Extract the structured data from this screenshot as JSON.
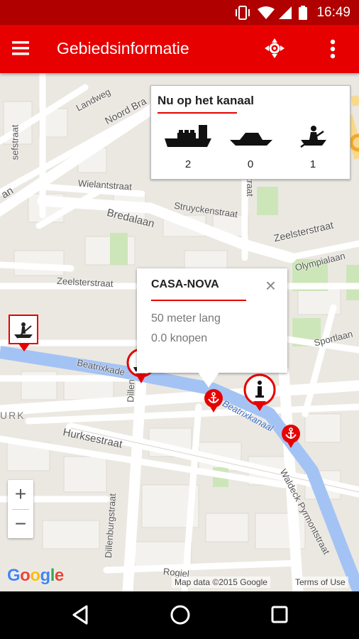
{
  "status_bar": {
    "time": "16:49"
  },
  "app_bar": {
    "title": "Gebiedsinformatie"
  },
  "panel": {
    "title": "Nu op het kanaal",
    "vessels": [
      {
        "name": "cargo-ship",
        "count": "2"
      },
      {
        "name": "motor-boat",
        "count": "0"
      },
      {
        "name": "rowing-boat",
        "count": "1"
      }
    ]
  },
  "popup": {
    "name": "CASA-NOVA",
    "close": "×",
    "line1": "50 meter lang",
    "line2": "0.0 knopen"
  },
  "streets": {
    "landweg": "Landweg",
    "noord_bra": "Noord Bra",
    "sefstraat": "sefstraat",
    "wielantstraat": "Wielantstraat",
    "struyckenstraat": "Struyckenstraat",
    "bredalaan": "Bredalaan",
    "zeelsterstraat_right": "Zeelsterstraat",
    "olympialaan": "Olympialaan",
    "zeelsterstraat_left": "Zeelsterstraat",
    "sportlaan": "Sportlaan",
    "beatrixkade": "Beatrixkade",
    "beatrixkanaal": "Beatrixkanaal",
    "dillenburgstraat": "Dillenburgstraat",
    "dillen": "Dillen",
    "hurksestraat": "Hurksestraat",
    "waldeck": "Waldeck Pyrmontstraat",
    "urk": "URK",
    "vertical_straat": "straat",
    "pan": "an",
    "rogiel": "Rogiel"
  },
  "zoom": {
    "plus": "+",
    "minus": "−"
  },
  "map_attribution": {
    "google": "Google",
    "data": "Map data ©2015 Google",
    "terms": "Terms of Use"
  },
  "colors": {
    "status_bar": "#b00000",
    "app_bar": "#e60000",
    "water": "#a4c3f5",
    "marker_red": "#e60000"
  }
}
